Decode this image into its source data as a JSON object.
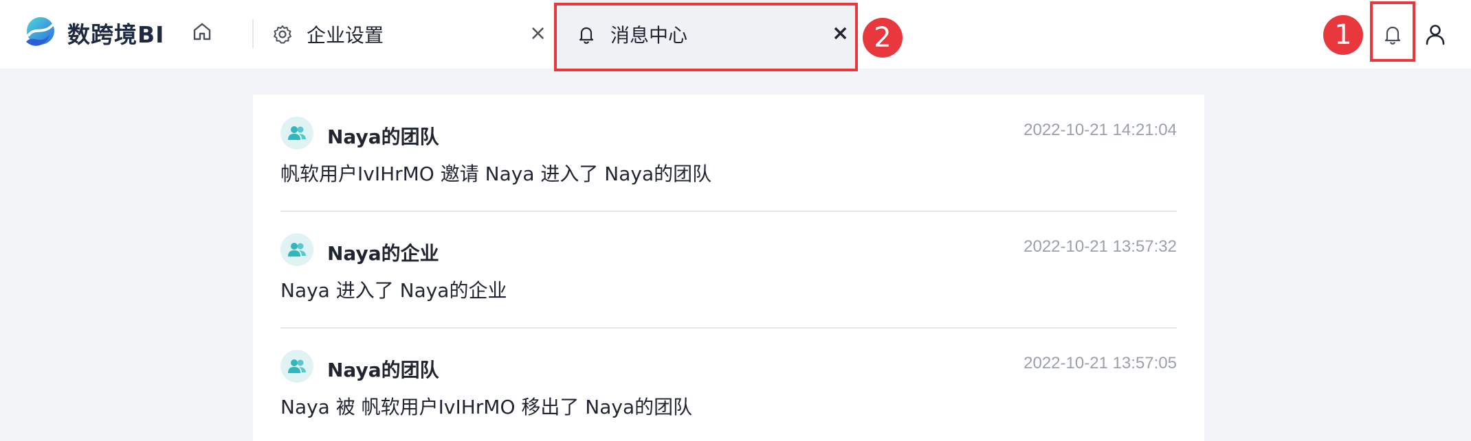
{
  "app": {
    "name": "数跨境BI"
  },
  "tabs": [
    {
      "label": "企业设置",
      "icon": "gear-icon",
      "close": "×"
    },
    {
      "label": "消息中心",
      "icon": "bell-icon",
      "close": "×"
    }
  ],
  "annotations": {
    "badge1": "1",
    "badge2": "2",
    "color": "#e8383e"
  },
  "messages": [
    {
      "title": "Naya的团队",
      "time": "2022-10-21 14:21:04",
      "body": "帆软用户IvIHrMO 邀请 Naya 进入了 Naya的团队"
    },
    {
      "title": "Naya的企业",
      "time": "2022-10-21 13:57:32",
      "body": "Naya 进入了 Naya的企业"
    },
    {
      "title": "Naya的团队",
      "time": "2022-10-21 13:57:05",
      "body": "Naya 被 帆软用户IvIHrMO 移出了 Naya的团队"
    }
  ],
  "colors": {
    "accent": "#2db7c0",
    "highlight": "#e8383e",
    "background": "#f2f3f6"
  }
}
